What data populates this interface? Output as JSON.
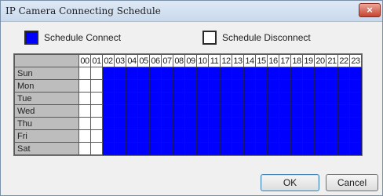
{
  "window": {
    "title": "IP Camera Connecting Schedule",
    "close_label": "×"
  },
  "legend": {
    "connect_label": "Schedule Connect",
    "disconnect_label": "Schedule Disconnect",
    "connect_color": "#0000ff",
    "disconnect_color": "#ffffff"
  },
  "schedule": {
    "hours": [
      "00",
      "01",
      "02",
      "03",
      "04",
      "05",
      "06",
      "07",
      "08",
      "09",
      "10",
      "11",
      "12",
      "13",
      "14",
      "15",
      "16",
      "17",
      "18",
      "19",
      "20",
      "21",
      "22",
      "23"
    ],
    "days": [
      "Sun",
      "Mon",
      "Tue",
      "Wed",
      "Thu",
      "Fri",
      "Sat"
    ],
    "connected_hours": [
      "02",
      "03",
      "04",
      "05",
      "06",
      "07",
      "08",
      "09",
      "10",
      "11",
      "12",
      "13",
      "14",
      "15",
      "16",
      "17",
      "18",
      "19",
      "20",
      "21",
      "22",
      "23"
    ],
    "disconnected_hours": [
      "00",
      "01"
    ]
  },
  "buttons": {
    "ok_label": "OK",
    "cancel_label": "Cancel"
  }
}
